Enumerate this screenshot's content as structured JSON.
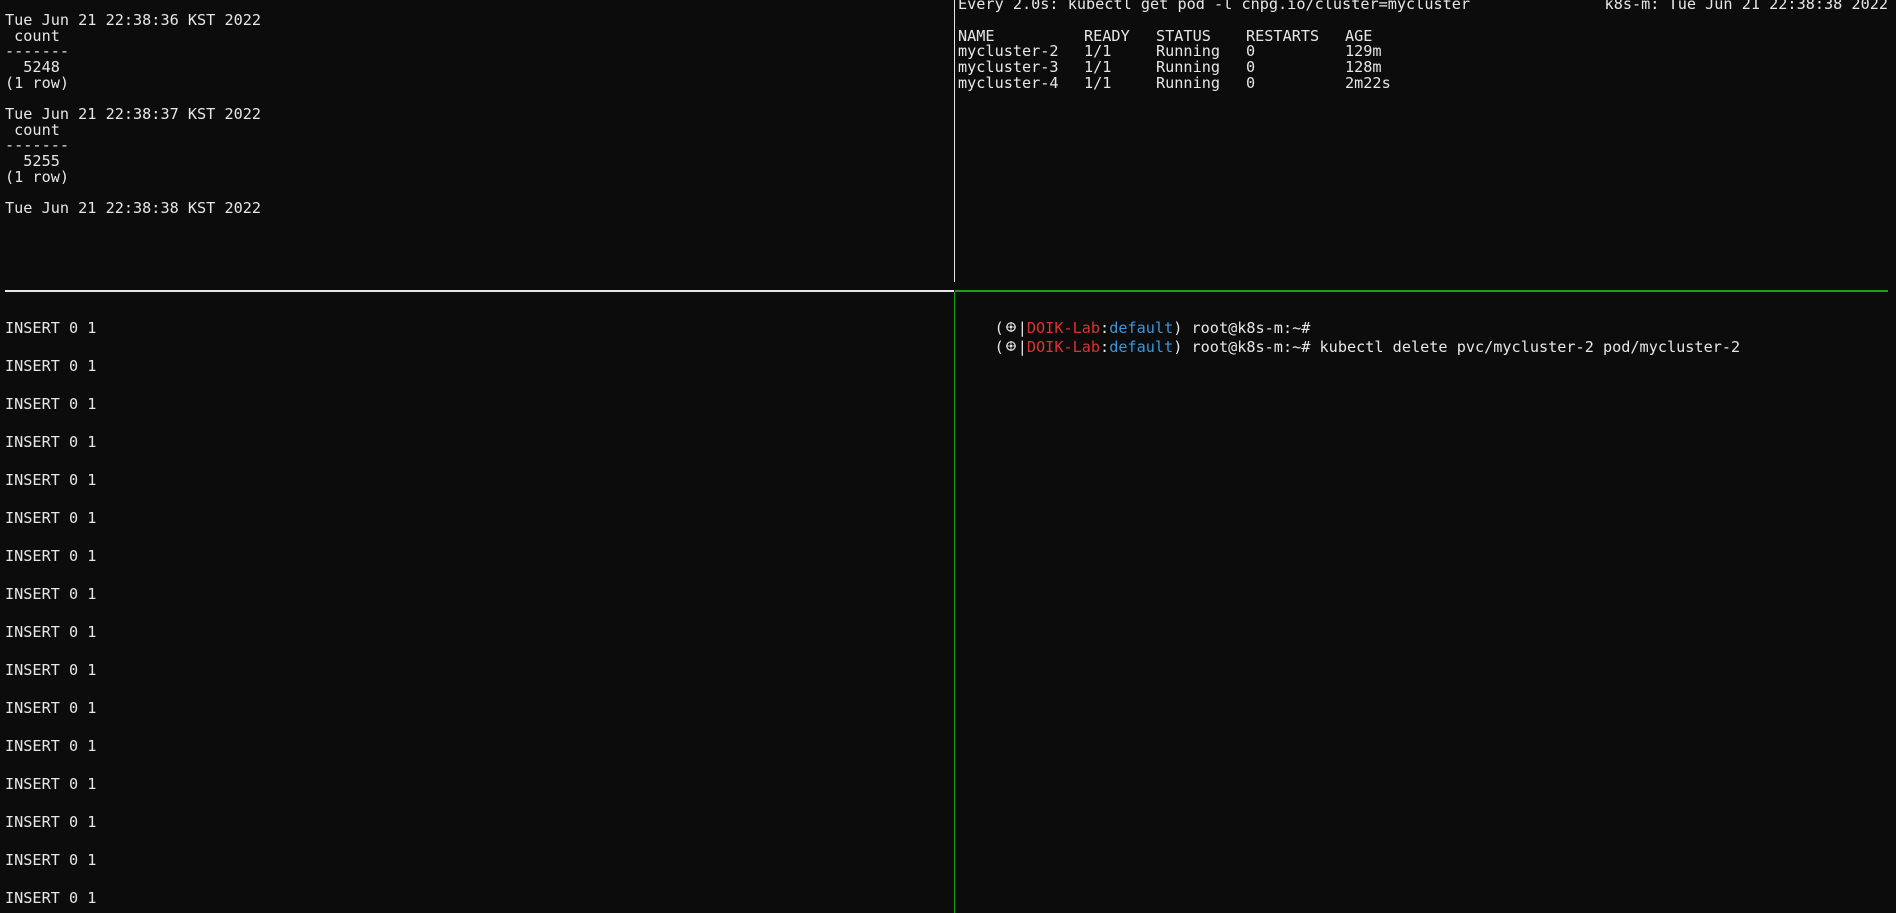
{
  "top_left": {
    "blocks": [
      {
        "timestamp": "Tue Jun 21 22:38:36 KST 2022",
        "header": " count",
        "rule": "-------",
        "value": "  5248",
        "rows": "(1 row)"
      },
      {
        "timestamp": "Tue Jun 21 22:38:37 KST 2022",
        "header": " count",
        "rule": "-------",
        "value": "  5255",
        "rows": "(1 row)"
      }
    ],
    "last_timestamp": "Tue Jun 21 22:38:38 KST 2022"
  },
  "top_right": {
    "watch_header": "Every 2.0s: kubectl get pod -l cnpg.io/cluster=mycluster",
    "watch_host_time": "k8s-m: Tue Jun 21 22:38:38 2022",
    "columns": [
      "NAME",
      "READY",
      "STATUS",
      "RESTARTS",
      "AGE"
    ],
    "rows": [
      [
        "mycluster-2",
        "1/1",
        "Running",
        "0",
        "129m"
      ],
      [
        "mycluster-3",
        "1/1",
        "Running",
        "0",
        "128m"
      ],
      [
        "mycluster-4",
        "1/1",
        "Running",
        "0",
        "2m22s"
      ]
    ]
  },
  "bottom_left": {
    "lines": [
      "INSERT 0 1",
      "INSERT 0 1",
      "INSERT 0 1",
      "INSERT 0 1",
      "INSERT 0 1",
      "INSERT 0 1",
      "INSERT 0 1",
      "INSERT 0 1",
      "INSERT 0 1",
      "INSERT 0 1",
      "INSERT 0 1",
      "INSERT 0 1",
      "INSERT 0 1",
      "INSERT 0 1",
      "INSERT 0 1",
      "INSERT 0 1"
    ]
  },
  "bottom_right": {
    "prompt": {
      "open": "(",
      "icon": "wheel-icon",
      "sep": "|",
      "context": "DOIK-Lab",
      "colon": ":",
      "namespace": "default",
      "close": ")",
      "user_host": " root@k8s-m:~#"
    },
    "commands": [
      "",
      " kubectl delete pvc/mycluster-2 pod/mycluster-2"
    ]
  },
  "colors": {
    "background": "#0c0c0c",
    "foreground": "#e6e6e6",
    "active_border": "#16a016",
    "prompt_context": "#e03030",
    "prompt_namespace": "#3a96dd"
  }
}
